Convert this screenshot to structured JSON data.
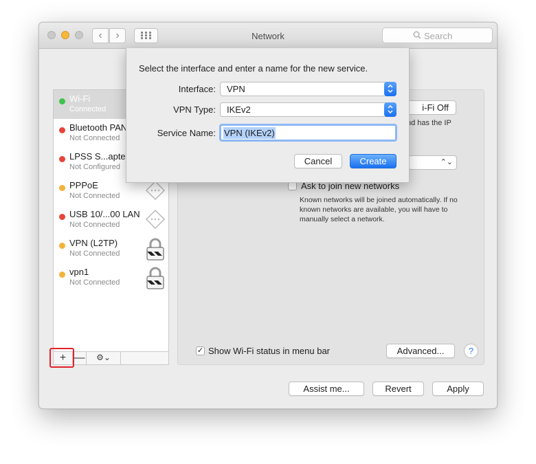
{
  "window": {
    "title": "Network"
  },
  "search": {
    "placeholder": "Search"
  },
  "services": [
    {
      "name": "Wi-Fi",
      "status": "Connected",
      "dot": "#3fc34b",
      "icon": ""
    },
    {
      "name": "Bluetooth PAN",
      "status": "Not Connected",
      "dot": "#e8443a",
      "icon": "bluetooth-icon"
    },
    {
      "name": "LPSS S...apter",
      "status": "Not Configured",
      "dot": "#e8443a",
      "icon": "ethernet-icon"
    },
    {
      "name": "PPPoE",
      "status": "Not Connected",
      "dot": "#f4b23c",
      "icon": "ethernet-icon"
    },
    {
      "name": "USB 10/...00 LAN",
      "status": "Not Connected",
      "dot": "#e8443a",
      "icon": "ethernet-icon"
    },
    {
      "name": "VPN (L2TP)",
      "status": "Not Connected",
      "dot": "#f4b23c",
      "icon": "lock-icon"
    },
    {
      "name": "vpn1",
      "status": "Not Connected",
      "dot": "#f4b23c",
      "icon": "lock-icon"
    }
  ],
  "sidebar_toolbar": {
    "add": "+",
    "remove": "—",
    "gear": "⚙⌄"
  },
  "content": {
    "wifi_off_button": "i-Fi Off",
    "ip_text_fragment": "nd has the IP",
    "ask_label": "Ask to join new networks",
    "ask_description": "Known networks will be joined automatically. If no known networks are available, you will have to manually select a network.",
    "show_status_label": "Show Wi-Fi status in menu bar",
    "show_status_checked": true,
    "advanced_button": "Advanced...",
    "help_button": "?"
  },
  "footer": {
    "assist": "Assist me...",
    "revert": "Revert",
    "apply": "Apply"
  },
  "sheet": {
    "prompt": "Select the interface and enter a name for the new service.",
    "interface_label": "Interface:",
    "interface_value": "VPN",
    "vpn_type_label": "VPN Type:",
    "vpn_type_value": "IKEv2",
    "service_name_label": "Service Name:",
    "service_name_value": "VPN (IKEv2)",
    "cancel": "Cancel",
    "create": "Create"
  },
  "colors": {
    "accent": "#1a70f0",
    "highlight": "#e0242a"
  }
}
